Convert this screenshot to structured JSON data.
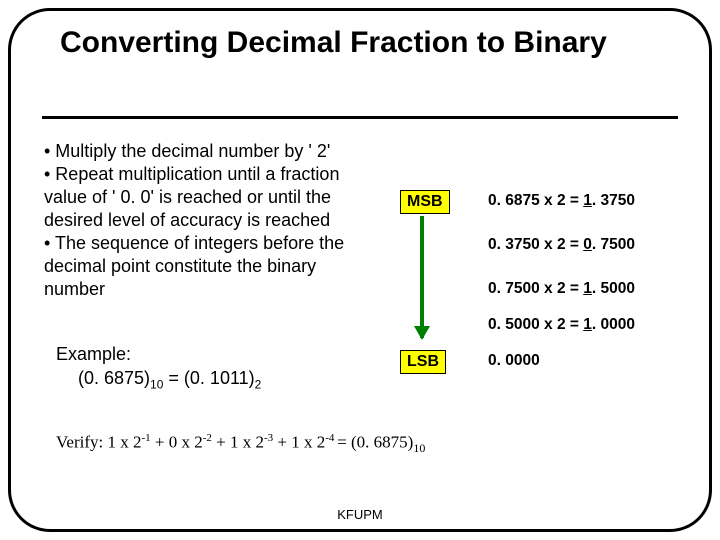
{
  "title": "Converting Decimal Fraction to Binary",
  "bullets": {
    "b1": "• Multiply the decimal number by ' 2'",
    "b2": "• Repeat multiplication until a fraction value of ' 0. 0' is reached or until the desired level of accuracy is reached",
    "b3": "• The sequence of integers before the decimal point constitute the binary number"
  },
  "example": {
    "label": "Example:",
    "lhs": "(0. 6875)",
    "lsub": "10",
    "eq": " = ",
    "rhs": "(0. 1011)",
    "rsub": "2"
  },
  "msb": "MSB",
  "lsb": "LSB",
  "calc": {
    "c1a": "0. 6875 x 2 = ",
    "c1b": "1",
    "c1c": ". 3750",
    "c2a": "0. 3750 x 2 = ",
    "c2b": "0",
    "c2c": ". 7500",
    "c3a": "0. 7500 x 2 = ",
    "c3b": "1",
    "c3c": ". 5000",
    "c4a": "0. 5000 x 2 = ",
    "c4b": "1",
    "c4c": ". 0000",
    "c5": "0. 0000"
  },
  "verify": {
    "pre": "Verify: 1 x 2",
    "e1": "-1",
    "m1": " + 0 x 2",
    "e2": "-2",
    "m2": " + 1 x 2",
    "e3": "-3",
    "m3": " + 1 x 2",
    "e4": "-4 ",
    "post": " = (0. 6875)",
    "sub": "10"
  },
  "footer": "KFUPM",
  "chart_data": {
    "type": "table",
    "title": "Decimal fraction to binary by repeated multiplication",
    "input_decimal": 0.6875,
    "output_binary": "0.1011",
    "steps": [
      {
        "fraction": 0.6875,
        "times2": 1.375,
        "integer_bit": 1
      },
      {
        "fraction": 0.375,
        "times2": 0.75,
        "integer_bit": 0
      },
      {
        "fraction": 0.75,
        "times2": 1.5,
        "integer_bit": 1
      },
      {
        "fraction": 0.5,
        "times2": 1.0,
        "integer_bit": 1
      },
      {
        "fraction": 0.0,
        "times2": null,
        "integer_bit": null
      }
    ],
    "msb_label": "MSB",
    "lsb_label": "LSB",
    "verify": "1·2^-1 + 0·2^-2 + 1·2^-3 + 1·2^-4 = 0.6875"
  }
}
